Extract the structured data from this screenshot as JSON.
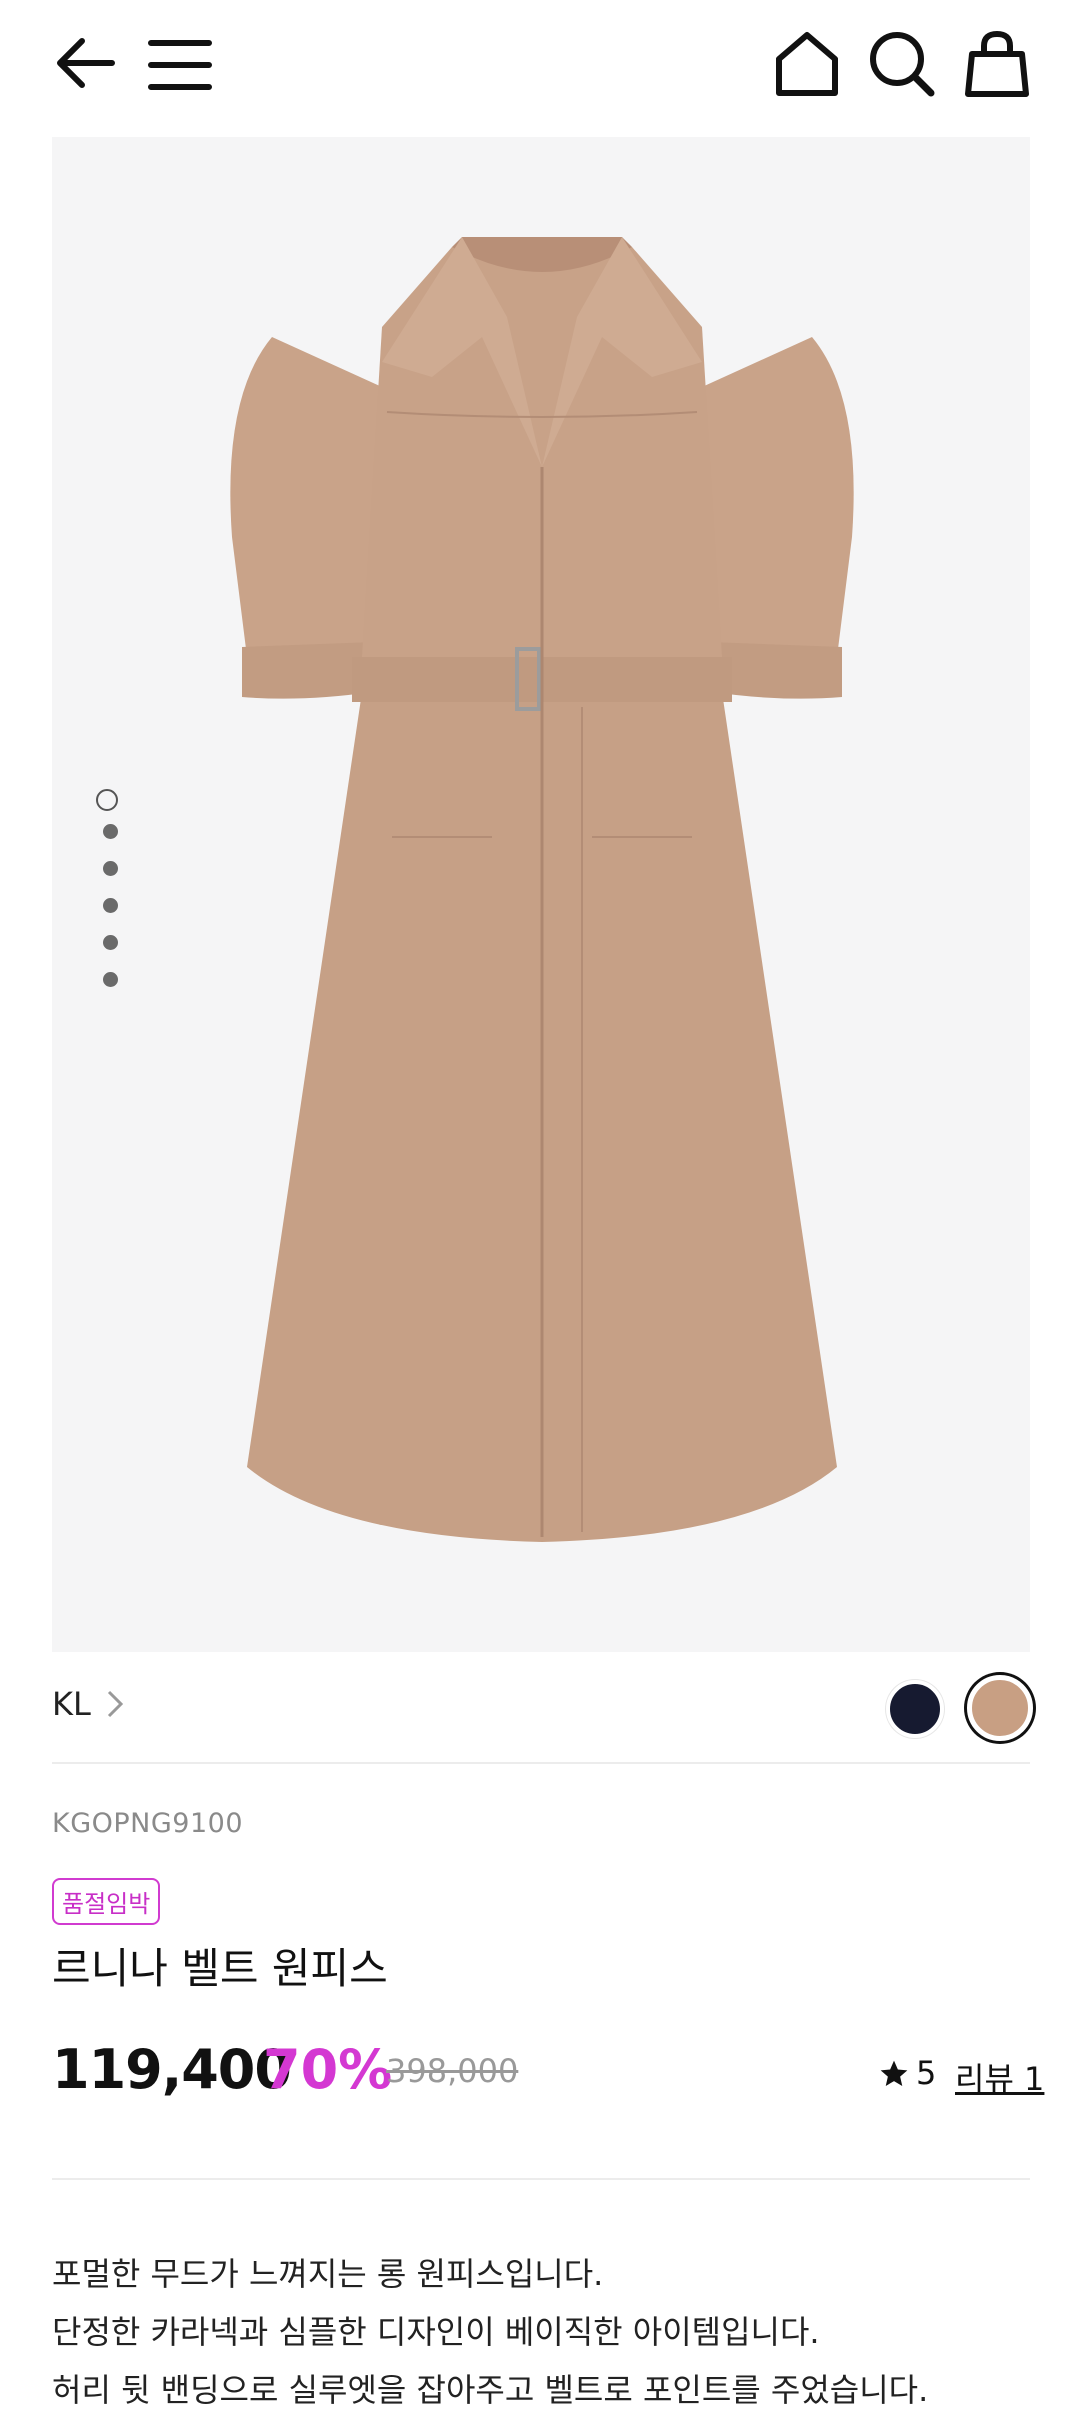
{
  "header": {
    "icons": [
      "back-arrow-icon",
      "menu-icon",
      "home-icon",
      "search-icon",
      "shopping-bag-icon"
    ]
  },
  "gallery": {
    "image_alt": "Beige belted shirt dress",
    "slide_count": 6,
    "active_slide": 1
  },
  "product": {
    "brand": "KL",
    "color_options": [
      {
        "name": "navy",
        "hex": "#161a30",
        "selected": false
      },
      {
        "name": "beige",
        "hex": "#c89f83",
        "selected": true
      }
    ],
    "sku": "KGOPNG9100",
    "badge": "품절임박",
    "name": "르니나 벨트 원피스",
    "price": "119,400",
    "discount": "70%",
    "original_price": "398,000",
    "rating": "5",
    "review_label": "리뷰 1",
    "description": [
      "포멀한 무드가 느껴지는 롱 원피스입니다.",
      "단정한 카라넥과 심플한 디자인이 베이직한 아이템입니다.",
      "허리 뒷 밴딩으로 실루엣을 잡아주고 벨트로 포인트를 주었습니다."
    ]
  },
  "colors": {
    "accent": "#d438d2",
    "dress": "#c8a288",
    "hero_bg": "#f5f5f6"
  }
}
